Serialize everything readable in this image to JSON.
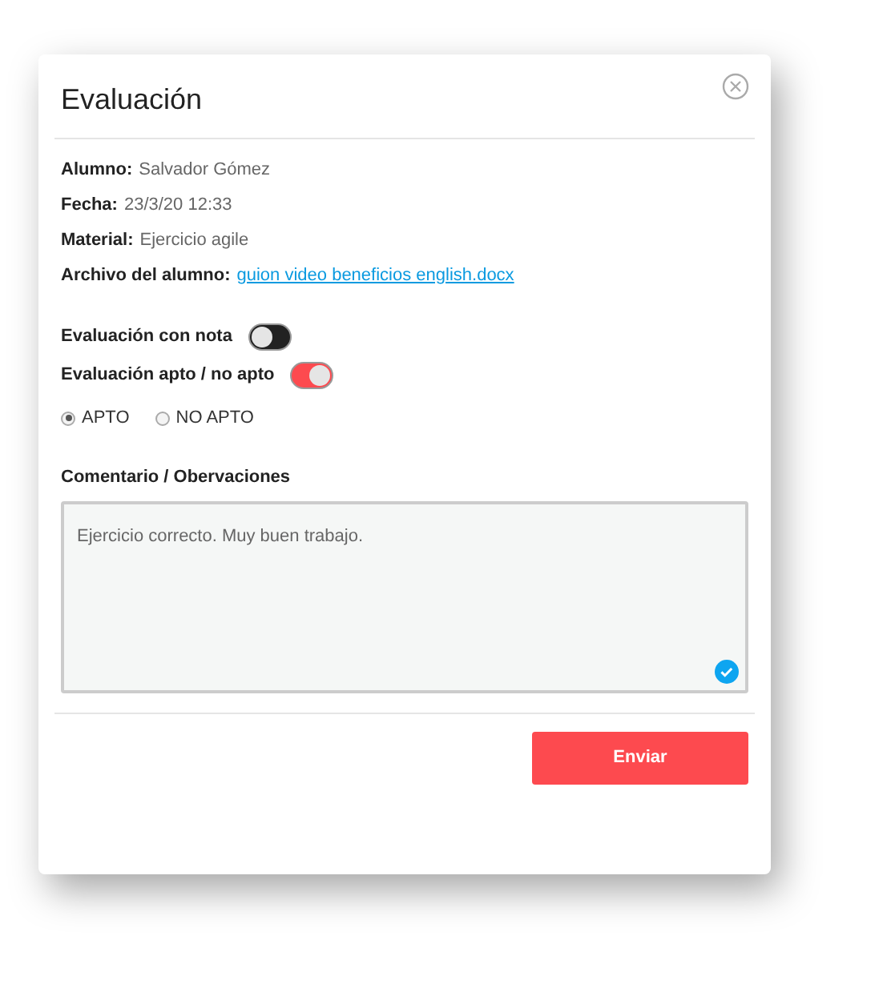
{
  "dialog": {
    "title": "Evaluación"
  },
  "fields": [
    {
      "label": "Alumno:",
      "value": "Salvador Gómez",
      "kind": "text"
    },
    {
      "label": "Fecha:",
      "value": "23/3/20 12:33",
      "kind": "text"
    },
    {
      "label": "Material:",
      "value": "Ejercicio agile",
      "kind": "text"
    },
    {
      "label": "Archivo del alumno:",
      "value": "guion video beneficios english.docx",
      "kind": "link"
    }
  ],
  "toggles": [
    {
      "label": "Evaluación con nota",
      "on": false
    },
    {
      "label": "Evaluación apto / no apto",
      "on": true
    }
  ],
  "radios": [
    {
      "label": "APTO",
      "selected": true
    },
    {
      "label": "NO APTO",
      "selected": false
    }
  ],
  "comment": {
    "label": "Comentario / Obervaciones",
    "value": "Ejercicio correcto. Muy buen trabajo."
  },
  "buttons": [
    "Enviar"
  ]
}
